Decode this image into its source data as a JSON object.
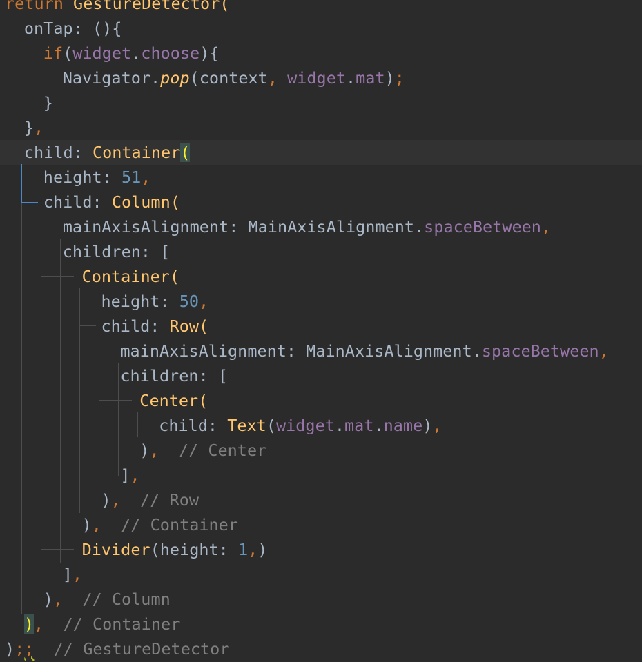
{
  "editor": {
    "lines": [
      {
        "indent": 0,
        "tokens": [
          {
            "t": "return ",
            "c": "kw"
          },
          {
            "t": "GestureDetector(",
            "c": "fn"
          }
        ]
      },
      {
        "indent": 1,
        "tokens": [
          {
            "t": "onTap: (){",
            "c": "p"
          }
        ]
      },
      {
        "indent": 2,
        "tokens": [
          {
            "t": "if",
            "c": "kw"
          },
          {
            "t": "(",
            "c": "p"
          },
          {
            "t": "widget",
            "c": "prop"
          },
          {
            "t": ".",
            "c": "p"
          },
          {
            "t": "choose",
            "c": "prop"
          },
          {
            "t": "){",
            "c": "p"
          }
        ]
      },
      {
        "indent": 3,
        "tokens": [
          {
            "t": "Navigator.",
            "c": "p"
          },
          {
            "t": "pop",
            "c": "it"
          },
          {
            "t": "(context",
            "c": "p"
          },
          {
            "t": ", ",
            "c": "kw"
          },
          {
            "t": "widget",
            "c": "prop"
          },
          {
            "t": ".",
            "c": "p"
          },
          {
            "t": "mat",
            "c": "prop"
          },
          {
            "t": ")",
            "c": "p"
          },
          {
            "t": ";",
            "c": "kw"
          }
        ]
      },
      {
        "indent": 2,
        "tokens": [
          {
            "t": "}",
            "c": "p"
          }
        ]
      },
      {
        "indent": 1,
        "tokens": [
          {
            "t": "}",
            "c": "p"
          },
          {
            "t": ",",
            "c": "kw"
          }
        ]
      },
      {
        "indent": 1,
        "tokens": [
          {
            "t": "child: ",
            "c": "p"
          },
          {
            "t": "Container",
            "c": "fn"
          },
          {
            "t": "(",
            "c": "hl"
          }
        ]
      },
      {
        "indent": 2,
        "tokens": [
          {
            "t": "height: ",
            "c": "p"
          },
          {
            "t": "51",
            "c": "num"
          },
          {
            "t": ",",
            "c": "kw"
          }
        ]
      },
      {
        "indent": 2,
        "tokens": [
          {
            "t": "child: ",
            "c": "p"
          },
          {
            "t": "Column(",
            "c": "fn"
          }
        ]
      },
      {
        "indent": 3,
        "tokens": [
          {
            "t": "mainAxisAlignment: MainAxisAlignment.",
            "c": "p"
          },
          {
            "t": "spaceBetween",
            "c": "prop"
          },
          {
            "t": ",",
            "c": "kw"
          }
        ]
      },
      {
        "indent": 3,
        "tokens": [
          {
            "t": "children: [",
            "c": "p"
          }
        ]
      },
      {
        "indent": 4,
        "tokens": [
          {
            "t": "Container(",
            "c": "fn"
          }
        ]
      },
      {
        "indent": 5,
        "tokens": [
          {
            "t": "height: ",
            "c": "p"
          },
          {
            "t": "50",
            "c": "num"
          },
          {
            "t": ",",
            "c": "kw"
          }
        ]
      },
      {
        "indent": 5,
        "tokens": [
          {
            "t": "child: ",
            "c": "p"
          },
          {
            "t": "Row(",
            "c": "fn"
          }
        ]
      },
      {
        "indent": 6,
        "tokens": [
          {
            "t": "mainAxisAlignment: MainAxisAlignment.",
            "c": "p"
          },
          {
            "t": "spaceBetween",
            "c": "prop"
          },
          {
            "t": ",",
            "c": "kw"
          }
        ]
      },
      {
        "indent": 6,
        "tokens": [
          {
            "t": "children: [",
            "c": "p"
          }
        ]
      },
      {
        "indent": 7,
        "tokens": [
          {
            "t": "Center(",
            "c": "fn"
          }
        ]
      },
      {
        "indent": 8,
        "tokens": [
          {
            "t": "child: ",
            "c": "p"
          },
          {
            "t": "Text",
            "c": "fn"
          },
          {
            "t": "(",
            "c": "p"
          },
          {
            "t": "widget",
            "c": "prop"
          },
          {
            "t": ".",
            "c": "p"
          },
          {
            "t": "mat",
            "c": "prop"
          },
          {
            "t": ".",
            "c": "p"
          },
          {
            "t": "name",
            "c": "prop"
          },
          {
            "t": ")",
            "c": "p"
          },
          {
            "t": ",",
            "c": "kw"
          }
        ]
      },
      {
        "indent": 7,
        "tokens": [
          {
            "t": ")",
            "c": "p"
          },
          {
            "t": ",",
            "c": "kw"
          },
          {
            "t": "  // Center",
            "c": "cm"
          }
        ]
      },
      {
        "indent": 6,
        "tokens": [
          {
            "t": "]",
            "c": "p"
          },
          {
            "t": ",",
            "c": "kw"
          }
        ]
      },
      {
        "indent": 5,
        "tokens": [
          {
            "t": ")",
            "c": "p"
          },
          {
            "t": ",",
            "c": "kw"
          },
          {
            "t": "  // Row",
            "c": "cm"
          }
        ]
      },
      {
        "indent": 4,
        "tokens": [
          {
            "t": ")",
            "c": "p"
          },
          {
            "t": ",",
            "c": "kw"
          },
          {
            "t": "  // Container",
            "c": "cm"
          }
        ]
      },
      {
        "indent": 4,
        "tokens": [
          {
            "t": "Divider",
            "c": "fn"
          },
          {
            "t": "(height: ",
            "c": "p"
          },
          {
            "t": "1",
            "c": "num"
          },
          {
            "t": ",",
            "c": "kw"
          },
          {
            "t": ")",
            "c": "p"
          }
        ]
      },
      {
        "indent": 3,
        "tokens": [
          {
            "t": "]",
            "c": "p"
          },
          {
            "t": ",",
            "c": "kw"
          }
        ]
      },
      {
        "indent": 2,
        "tokens": [
          {
            "t": ")",
            "c": "p"
          },
          {
            "t": ",",
            "c": "kw"
          },
          {
            "t": "  // Column",
            "c": "cm"
          }
        ]
      },
      {
        "indent": 1,
        "tokens": [
          {
            "t": ")",
            "c": "hl"
          },
          {
            "t": ",",
            "c": "kw"
          },
          {
            "t": "  // Container",
            "c": "cm"
          }
        ]
      },
      {
        "indent": 0,
        "tokens": [
          {
            "t": ")",
            "c": "p"
          },
          {
            "t": ";",
            "c": "kw"
          },
          {
            "t": ";",
            "c": "warn"
          },
          {
            "t": "  // GestureDetector",
            "c": "cm"
          }
        ]
      }
    ]
  },
  "colors": {
    "background": "#2b2b2b",
    "caret_row": "#323232",
    "keyword": "#cc7832",
    "function": "#ffc66d",
    "number": "#6897bb",
    "property": "#9876aa",
    "comment": "#808080",
    "text": "#a9b7c6",
    "guide": "#4d4d4d",
    "active_guide": "#4a88c7"
  }
}
